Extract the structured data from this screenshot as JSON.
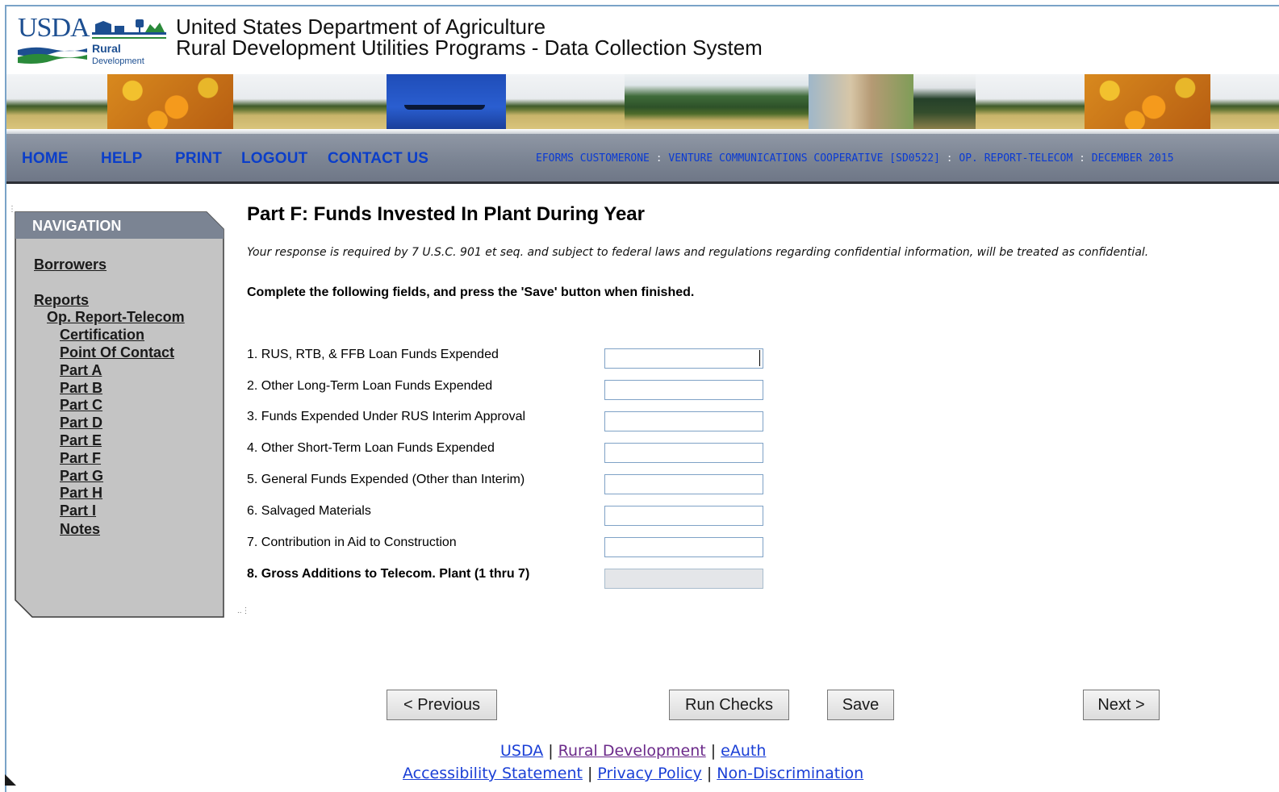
{
  "header": {
    "logo": {
      "usda": "USDA",
      "rural": "Rural",
      "development": "Development"
    },
    "title_line1": "United States Department of Agriculture",
    "title_line2": "Rural Development Utilities Programs - Data Collection System"
  },
  "topnav": {
    "home": "HOME",
    "help": "HELP",
    "print": "PRINT",
    "logout": "LOGOUT",
    "contact": "CONTACT US"
  },
  "breadcrumb": {
    "user": "EFORMS CUSTOMERONE",
    "org": "VENTURE COMMUNICATIONS COOPERATIVE [SD0522]",
    "report": "OP. REPORT-TELECOM",
    "period": "DECEMBER 2015",
    "separator": ":"
  },
  "sidebar": {
    "title": "NAVIGATION",
    "borrowers": "Borrowers",
    "reports": "Reports",
    "report_name": "Op. Report-Telecom",
    "items": [
      "Certification",
      "Point Of Contact",
      "Part A",
      "Part B",
      "Part C",
      "Part D",
      "Part E",
      "Part F",
      "Part G",
      "Part H",
      "Part I",
      "Notes"
    ]
  },
  "main": {
    "title": "Part F: Funds Invested In Plant During Year",
    "notice": "Your response is required by 7 U.S.C. 901 et seq. and subject to federal laws and regulations regarding confidential information, will be treated as confidential.",
    "instruction": "Complete the following fields, and press the 'Save' button when finished.",
    "fields": [
      {
        "label": "1. RUS, RTB, & FFB Loan Funds Expended",
        "value": ""
      },
      {
        "label": "2. Other Long-Term Loan Funds Expended",
        "value": ""
      },
      {
        "label": "3. Funds Expended Under RUS Interim Approval",
        "value": ""
      },
      {
        "label": "4. Other Short-Term Loan Funds Expended",
        "value": ""
      },
      {
        "label": "5. General Funds Expended (Other than Interim)",
        "value": ""
      },
      {
        "label": "6. Salvaged Materials",
        "value": ""
      },
      {
        "label": "7. Contribution in Aid to Construction",
        "value": ""
      },
      {
        "label": "8. Gross Additions to Telecom. Plant (1 thru 7)",
        "value": ""
      }
    ]
  },
  "buttons": {
    "previous": "< Previous",
    "run_checks": "Run Checks",
    "save": "Save",
    "next": "Next >"
  },
  "footer": {
    "usda": "USDA",
    "rural_development": "Rural Development",
    "eauth": "eAuth",
    "accessibility": "Accessibility Statement",
    "privacy": "Privacy Policy",
    "non_discrimination": "Non-Discrimination",
    "separator": "|"
  },
  "colors": {
    "nav_link": "#0b3ec9",
    "navbar_bg": "#7b8493",
    "sidebar_bg": "#c4c4c4",
    "sidebar_header": "#7b8493",
    "link": "#1a3fd6",
    "visited_link": "#6b2a8a"
  }
}
